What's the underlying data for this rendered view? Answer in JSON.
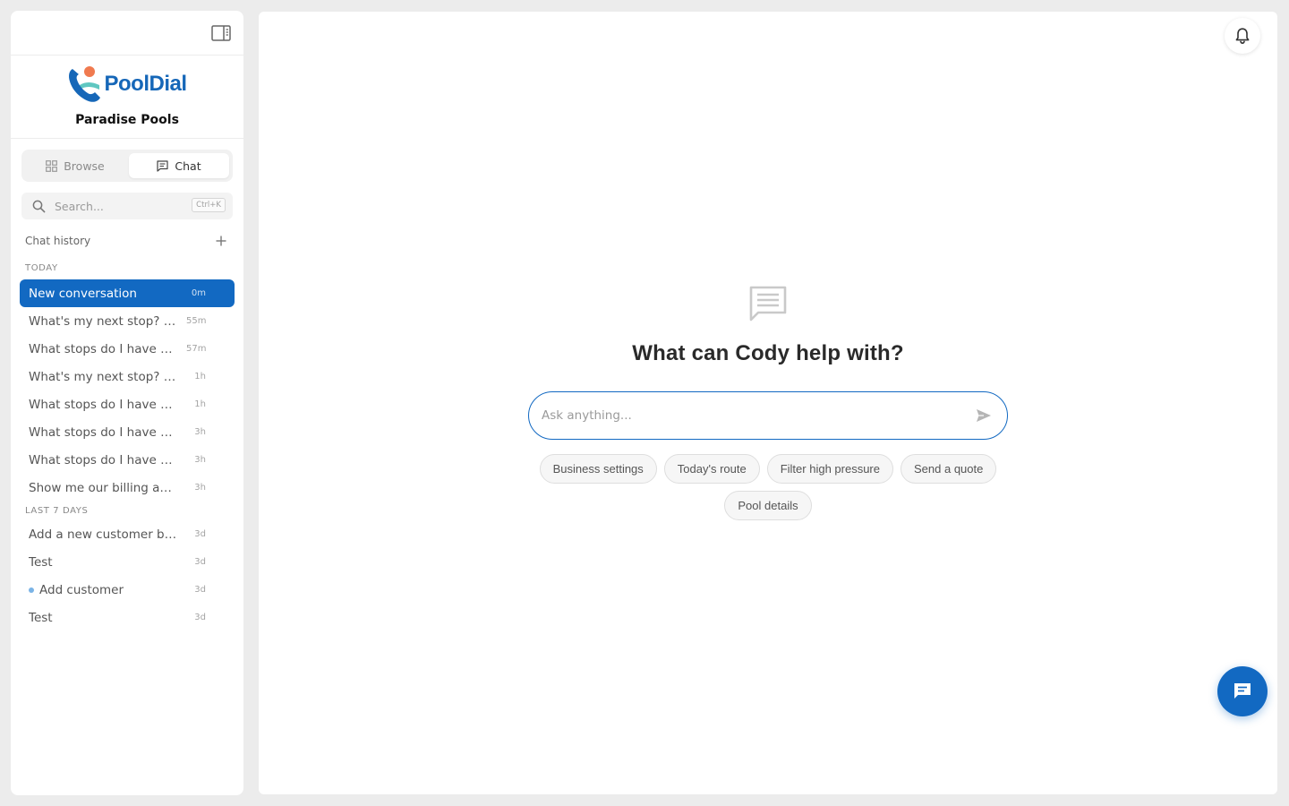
{
  "brand": {
    "name": "PoolDial",
    "business": "Paradise Pools",
    "accent": "#1269c2"
  },
  "tabs": {
    "browse": "Browse",
    "chat": "Chat",
    "active": "chat"
  },
  "search": {
    "placeholder": "Search...",
    "shortcut": "Ctrl+K"
  },
  "history": {
    "title": "Chat history",
    "groups": [
      {
        "label": "TODAY",
        "items": [
          {
            "title": "New conversation",
            "time": "0m",
            "active": true
          },
          {
            "title": "What's my next stop? And",
            "time": "55m"
          },
          {
            "title": "What stops do I have on my route",
            "time": "57m"
          },
          {
            "title": "What's my next stop? And what",
            "time": "1h"
          },
          {
            "title": "What stops do I have on my route",
            "time": "1h"
          },
          {
            "title": "What stops do I have on my route",
            "time": "3h"
          },
          {
            "title": "What stops do I have on my route",
            "time": "3h"
          },
          {
            "title": "Show me our billing and settings",
            "time": "3h"
          }
        ]
      },
      {
        "label": "LAST 7 DAYS",
        "items": [
          {
            "title": "Add a new customer bob",
            "time": "3d"
          },
          {
            "title": "Test",
            "time": "3d"
          },
          {
            "title": "Add customer",
            "time": "3d",
            "unread": true
          },
          {
            "title": "Test",
            "time": "3d"
          }
        ]
      }
    ]
  },
  "main": {
    "headline": "What can Cody help with?",
    "composer_placeholder": "Ask anything...",
    "suggestions": [
      "Business settings",
      "Today's route",
      "Filter high pressure",
      "Send a quote",
      "Pool details"
    ]
  },
  "icons": {
    "sidebar_toggle": "sidebar-toggle-icon",
    "browse": "grid-icon",
    "chat": "chat-icon",
    "search": "search-icon",
    "new_chat": "plus-icon",
    "notifications": "bell-icon",
    "send": "send-icon",
    "fab": "message-icon"
  }
}
